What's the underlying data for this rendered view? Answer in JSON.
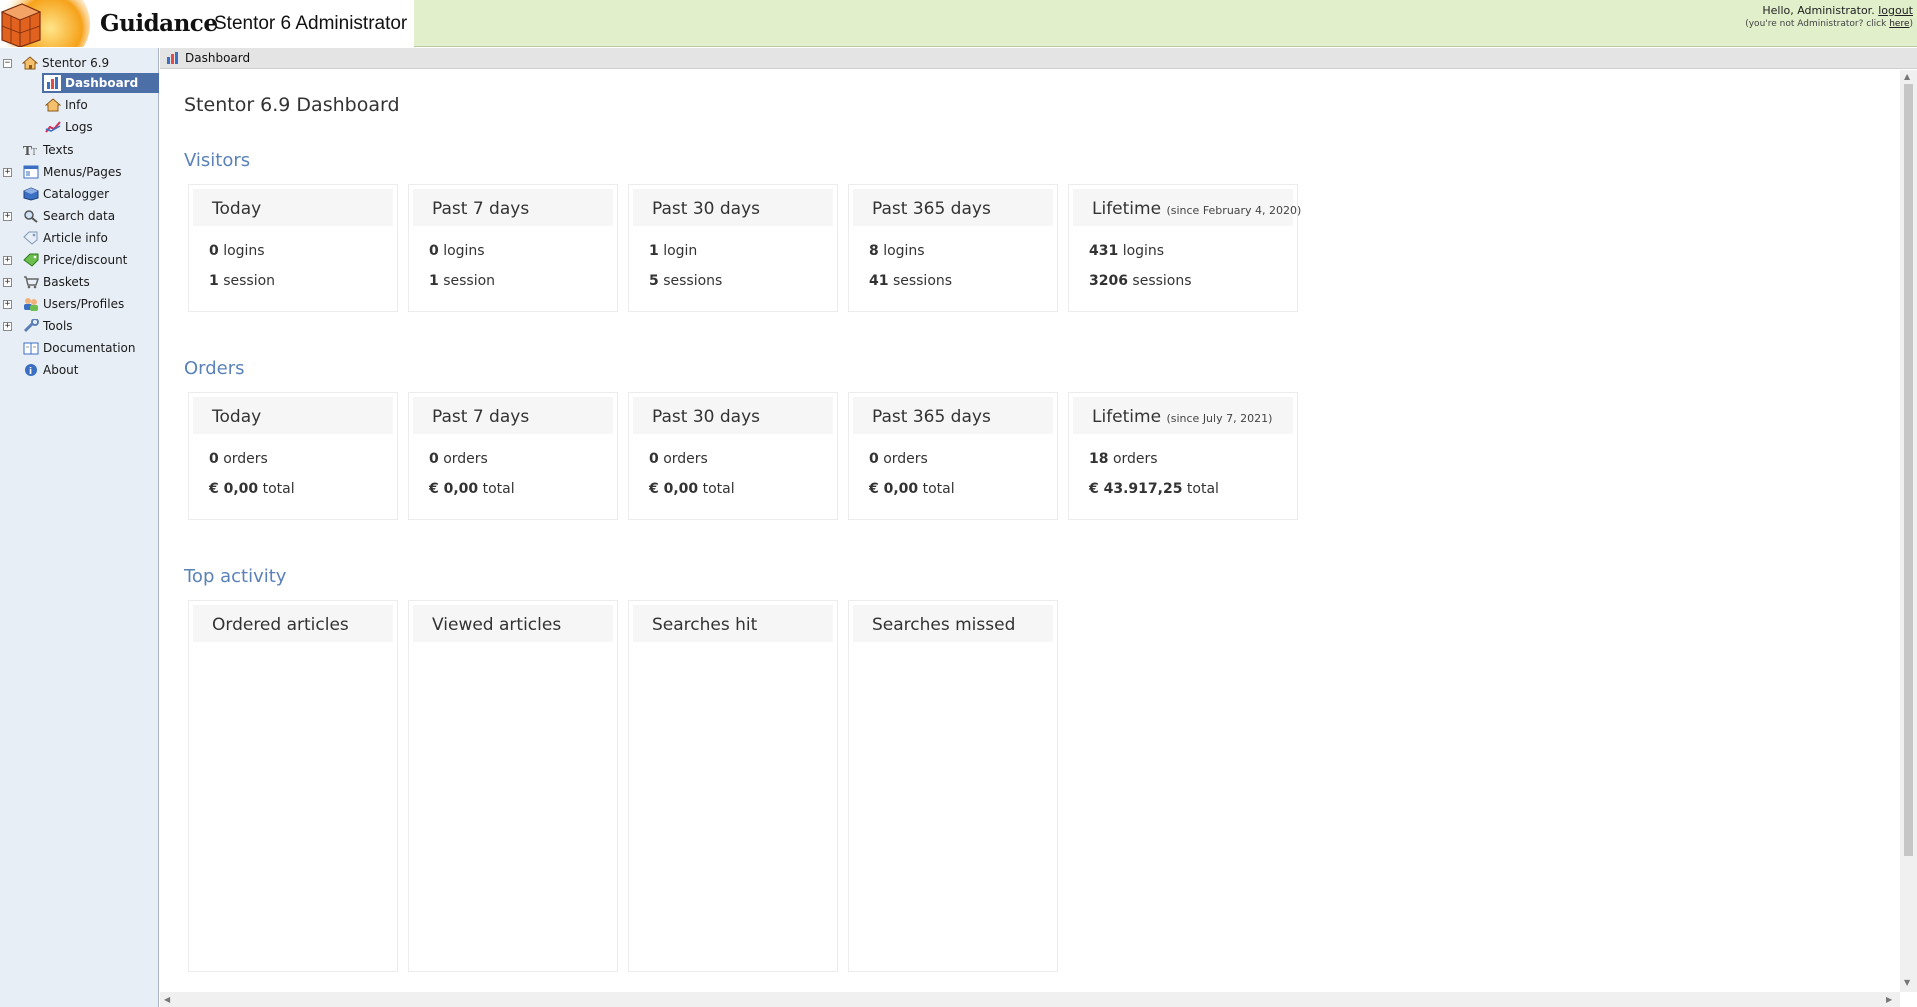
{
  "header": {
    "brand": "Guidance",
    "product": "Stentor 6 Administrator",
    "greeting": "Hello, Administrator.",
    "logout": "logout",
    "not_admin_prefix": "(you're not Administrator? click ",
    "not_admin_link": "here",
    "not_admin_suffix": ")"
  },
  "sidebar": {
    "root": "Stentor 6.9",
    "items": [
      {
        "label": "Dashboard",
        "icon": "dashboard-icon",
        "selected": true
      },
      {
        "label": "Info",
        "icon": "home-icon"
      },
      {
        "label": "Logs",
        "icon": "chart-line-icon"
      },
      {
        "label": "Texts",
        "icon": "text-icon"
      },
      {
        "label": "Menus/Pages",
        "icon": "pages-icon"
      },
      {
        "label": "Catalogger",
        "icon": "box-icon"
      },
      {
        "label": "Search data",
        "icon": "search-icon"
      },
      {
        "label": "Article info",
        "icon": "tag-icon"
      },
      {
        "label": "Price/discount",
        "icon": "price-tag-icon"
      },
      {
        "label": "Baskets",
        "icon": "basket-icon"
      },
      {
        "label": "Users/Profiles",
        "icon": "users-icon"
      },
      {
        "label": "Tools",
        "icon": "wrench-icon"
      },
      {
        "label": "Documentation",
        "icon": "book-icon"
      },
      {
        "label": "About",
        "icon": "info-icon"
      }
    ]
  },
  "breadcrumb": "Dashboard",
  "main": {
    "title": "Stentor 6.9 Dashboard",
    "visitors": {
      "title": "Visitors",
      "cards": [
        {
          "label": "Today",
          "logins": "0",
          "logins_label": "logins",
          "sessions": "1",
          "sessions_label": "session"
        },
        {
          "label": "Past 7 days",
          "logins": "0",
          "logins_label": "logins",
          "sessions": "1",
          "sessions_label": "session"
        },
        {
          "label": "Past 30 days",
          "logins": "1",
          "logins_label": "login",
          "sessions": "5",
          "sessions_label": "sessions"
        },
        {
          "label": "Past 365 days",
          "logins": "8",
          "logins_label": "logins",
          "sessions": "41",
          "sessions_label": "sessions"
        },
        {
          "label": "Lifetime",
          "since": "(since February 4, 2020)",
          "logins": "431",
          "logins_label": "logins",
          "sessions": "3206",
          "sessions_label": "sessions"
        }
      ]
    },
    "orders": {
      "title": "Orders",
      "cards": [
        {
          "label": "Today",
          "orders": "0",
          "orders_label": "orders",
          "total": "€ 0,00",
          "total_label": "total"
        },
        {
          "label": "Past 7 days",
          "orders": "0",
          "orders_label": "orders",
          "total": "€ 0,00",
          "total_label": "total"
        },
        {
          "label": "Past 30 days",
          "orders": "0",
          "orders_label": "orders",
          "total": "€ 0,00",
          "total_label": "total"
        },
        {
          "label": "Past 365 days",
          "orders": "0",
          "orders_label": "orders",
          "total": "€ 0,00",
          "total_label": "total"
        },
        {
          "label": "Lifetime",
          "since": "(since July 7, 2021)",
          "orders": "18",
          "orders_label": "orders",
          "total": "€ 43.917,25",
          "total_label": "total"
        }
      ]
    },
    "top_activity": {
      "title": "Top activity",
      "cards": [
        {
          "label": "Ordered articles"
        },
        {
          "label": "Viewed articles"
        },
        {
          "label": "Searches hit"
        },
        {
          "label": "Searches missed"
        }
      ]
    }
  },
  "colors": {
    "header_bg": "#e1efcb",
    "sidebar_bg": "#e8eef6",
    "selected_bg": "#4d6fa8",
    "section_title": "#5a82b8"
  }
}
